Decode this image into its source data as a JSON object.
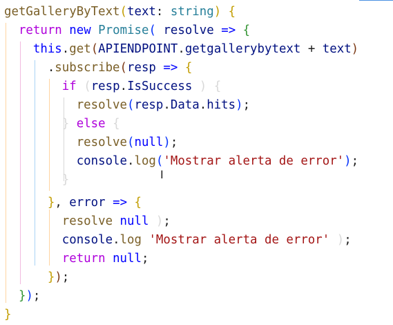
{
  "editor": {
    "lines": [
      [
        [
          "fn",
          "getGalleryByText"
        ],
        [
          "b0",
          "("
        ],
        [
          "vr",
          "text"
        ],
        [
          "op",
          ": "
        ],
        [
          "ty",
          "string"
        ],
        [
          "b0",
          ")"
        ],
        [
          "op",
          " "
        ],
        [
          "b0",
          "{"
        ]
      ],
      [
        [
          "op",
          "  "
        ],
        [
          "ctl",
          "return"
        ],
        [
          "op",
          " "
        ],
        [
          "kw",
          "new"
        ],
        [
          "op",
          " "
        ],
        [
          "ty",
          "Promise"
        ],
        [
          "b1",
          "("
        ],
        [
          "op",
          " "
        ],
        [
          "vr",
          "resolve"
        ],
        [
          "op",
          " "
        ],
        [
          "kw",
          "=>"
        ],
        [
          "op",
          " "
        ],
        [
          "b2",
          "{"
        ]
      ],
      [
        [
          "op",
          "    "
        ],
        [
          "kw",
          "this"
        ],
        [
          "op",
          "."
        ],
        [
          "fn",
          "get"
        ],
        [
          "b3",
          "("
        ],
        [
          "vr",
          "APIENDPOINT"
        ],
        [
          "op",
          "."
        ],
        [
          "vr",
          "getgallerybytext"
        ],
        [
          "op",
          " + "
        ],
        [
          "vr",
          "text"
        ],
        [
          "b3",
          ")"
        ]
      ],
      [
        [
          "op",
          "      ."
        ],
        [
          "fn",
          "subscribe"
        ],
        [
          "b3",
          "("
        ],
        [
          "vr",
          "resp"
        ],
        [
          "op",
          " "
        ],
        [
          "kw",
          "=>"
        ],
        [
          "op",
          " "
        ],
        [
          "b0",
          "{"
        ]
      ],
      [
        [
          "op",
          "        "
        ],
        [
          "ctl",
          "if"
        ],
        [
          "op",
          " "
        ],
        [
          "ph",
          "("
        ],
        [
          "vr",
          "resp"
        ],
        [
          "op",
          "."
        ],
        [
          "vr",
          "IsSuccess"
        ],
        [
          "op",
          " "
        ],
        [
          "ph",
          ")"
        ],
        [
          "op",
          " "
        ],
        [
          "ph",
          "{"
        ]
      ],
      [
        [
          "op",
          "          "
        ],
        [
          "fn",
          "resolve"
        ],
        [
          "b1",
          "("
        ],
        [
          "vr",
          "resp"
        ],
        [
          "op",
          "."
        ],
        [
          "vr",
          "Data"
        ],
        [
          "op",
          "."
        ],
        [
          "vr",
          "hits"
        ],
        [
          "b1",
          ")"
        ],
        [
          "op",
          ";"
        ]
      ],
      [
        [
          "op",
          "        "
        ],
        [
          "ph",
          "}"
        ],
        [
          "op",
          " "
        ],
        [
          "ctl",
          "else"
        ],
        [
          "op",
          " "
        ],
        [
          "ph",
          "{"
        ]
      ],
      [
        [
          "op",
          "          "
        ],
        [
          "fn",
          "resolve"
        ],
        [
          "b1",
          "("
        ],
        [
          "kw",
          "null"
        ],
        [
          "b1",
          ")"
        ],
        [
          "op",
          ";"
        ]
      ],
      [
        [
          "op",
          "          "
        ],
        [
          "vr",
          "console"
        ],
        [
          "op",
          "."
        ],
        [
          "fn",
          "log"
        ],
        [
          "b1",
          "("
        ],
        [
          "st",
          "'Mostrar alerta de error'"
        ],
        [
          "b1",
          ")"
        ],
        [
          "op",
          ";"
        ]
      ],
      [
        [
          "op",
          "        "
        ],
        [
          "ph",
          "}"
        ]
      ],
      [
        [
          "op",
          ""
        ]
      ],
      [
        [
          "op",
          "      "
        ],
        [
          "b0",
          "}"
        ],
        [
          "op",
          ", "
        ],
        [
          "vr",
          "error"
        ],
        [
          "op",
          " "
        ],
        [
          "kw",
          "=>"
        ],
        [
          "op",
          " "
        ],
        [
          "b0",
          "{"
        ]
      ],
      [
        [
          "op",
          "        "
        ],
        [
          "fn",
          "resolve"
        ],
        [
          "op",
          " "
        ],
        [
          "kw",
          "null"
        ],
        [
          "op",
          " "
        ],
        [
          "ph",
          ")"
        ],
        [
          "op",
          ";"
        ]
      ],
      [
        [
          "op",
          "        "
        ],
        [
          "vr",
          "console"
        ],
        [
          "op",
          "."
        ],
        [
          "fn",
          "log"
        ],
        [
          "op",
          " "
        ],
        [
          "st",
          "'Mostrar alerta de error'"
        ],
        [
          "op",
          " "
        ],
        [
          "ph",
          ")"
        ],
        [
          "op",
          ";"
        ]
      ],
      [
        [
          "op",
          "        "
        ],
        [
          "ctl",
          "return"
        ],
        [
          "op",
          " "
        ],
        [
          "kw",
          "null"
        ],
        [
          "op",
          ";"
        ]
      ],
      [
        [
          "op",
          "      "
        ],
        [
          "b0",
          "}"
        ],
        [
          "b3",
          ")"
        ],
        [
          "op",
          ";"
        ]
      ],
      [
        [
          "op",
          "  "
        ],
        [
          "b2",
          "}"
        ],
        [
          "b1",
          ")"
        ],
        [
          "op",
          ";"
        ]
      ],
      [
        [
          "b0",
          "}"
        ]
      ]
    ]
  },
  "cursor_icon": "text-cursor-icon",
  "colors": {
    "background": "#ffffff",
    "function": "#795e26",
    "type": "#267f99",
    "keyword": "#0000ff",
    "control": "#af00db",
    "variable": "#001080",
    "string": "#a31515"
  }
}
